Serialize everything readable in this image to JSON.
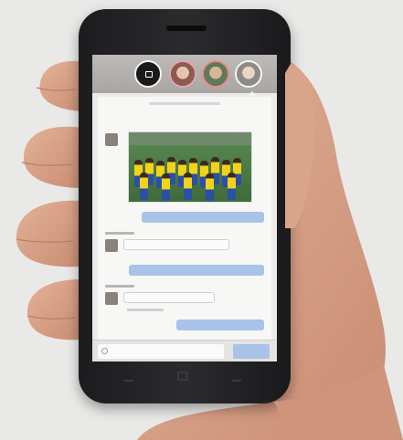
{
  "scene": {
    "subject": "smartphone-held-in-hand",
    "colors": {
      "background": "#e9e9e7",
      "skin": "#d9a58a",
      "phone_body": "#232326",
      "screen_background": "#ecebea",
      "topbar": "#b3b0ad",
      "outgoing_bubble": "#a9c2e8",
      "incoming_bubble": "#fbfbfb",
      "jersey_yellow": "#f2d21b",
      "jersey_blue": "#2a4fa8",
      "pitch_green": "#4f7f48"
    }
  },
  "phone": {
    "status_bubbles": [
      {
        "icon": "message-icon"
      },
      {
        "icon": "contact-avatar-icon"
      },
      {
        "icon": "contact-avatar-icon"
      },
      {
        "icon": "contact-avatar-icon"
      }
    ],
    "chat": {
      "photo_icon": "team-photo",
      "composer_icon": "emoji-icon"
    },
    "nav_keys": [
      "back-icon",
      "home-icon",
      "menu-icon"
    ]
  }
}
